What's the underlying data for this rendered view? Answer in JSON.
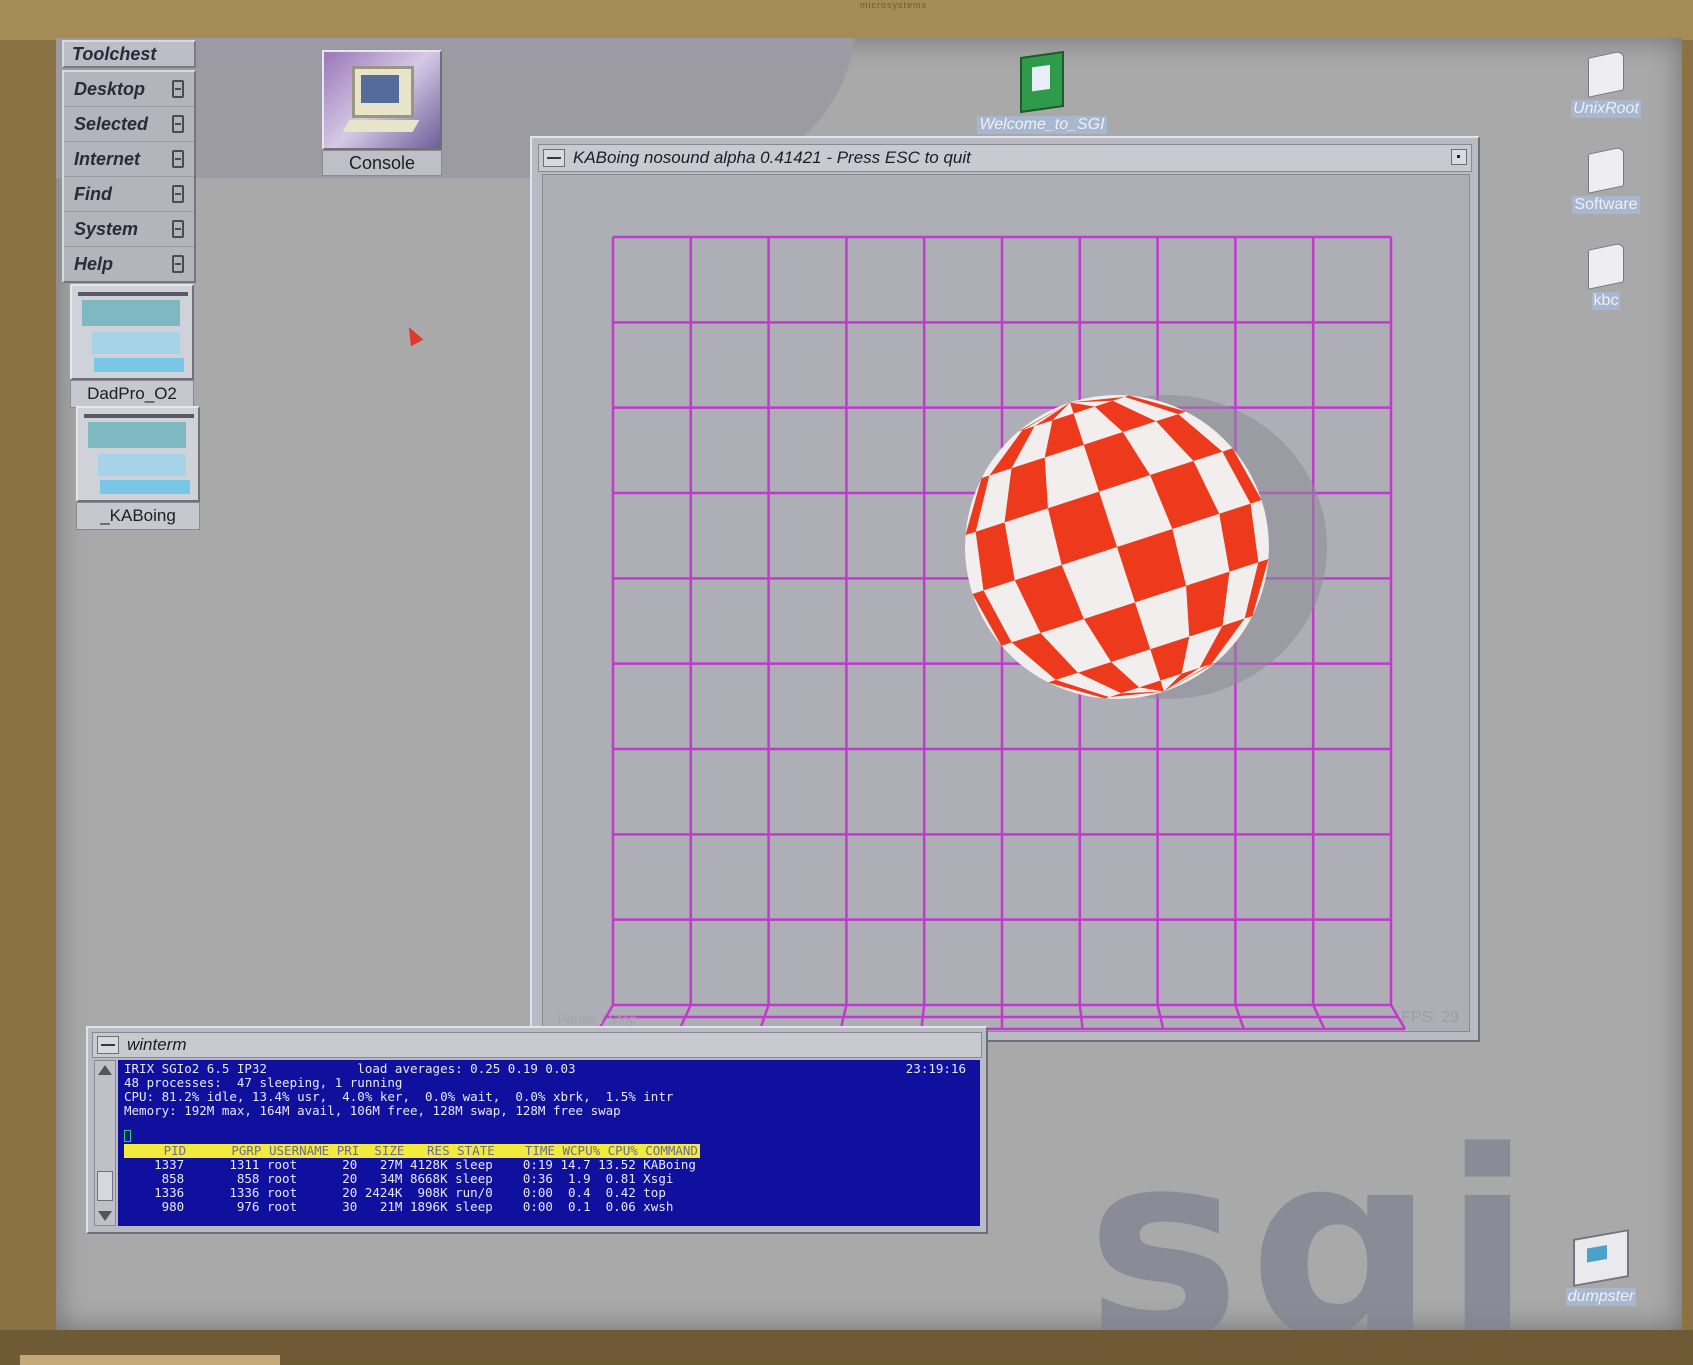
{
  "bezel": {
    "brand": "microsystems"
  },
  "toolchest": {
    "title": "Toolchest",
    "items": [
      {
        "label": "Desktop"
      },
      {
        "label": "Selected"
      },
      {
        "label": "Internet"
      },
      {
        "label": "Find"
      },
      {
        "label": "System"
      },
      {
        "label": "Help"
      }
    ]
  },
  "minimized_windows": [
    {
      "label": "DadPro_O2"
    },
    {
      "label": "_KABoing"
    }
  ],
  "console_icon": {
    "label": "Console"
  },
  "desktop_icons": {
    "welcome": {
      "label": "Welcome_to_SGI"
    },
    "unixroot": {
      "label": "UnixRoot"
    },
    "software": {
      "label": "Software"
    },
    "kbc": {
      "label": "kbc"
    },
    "dumpster": {
      "label": "dumpster"
    }
  },
  "kaboing_window": {
    "title": "KABoing nosound alpha 0.41421 - Press ESC to quit",
    "fps": "FPS: 29",
    "faint_text": "Pause / Stop",
    "colors": {
      "grid": "#c23acd",
      "ball_red": "#ee3a1c",
      "ball_white": "#f3eeee",
      "shadow": "#8c8d96"
    },
    "ball": {
      "rotation_deg": -18
    }
  },
  "winterm": {
    "title": "winterm",
    "time": "23:19:16",
    "lines": [
      "IRIX SGIo2 6.5 IP32            load averages: 0.25 0.19 0.03",
      "48 processes:  47 sleeping, 1 running",
      "CPU: 81.2% idle, 13.4% usr,  4.0% ker,  0.0% wait,  0.0% xbrk,  1.5% intr",
      "Memory: 192M max, 164M avail, 106M free, 128M swap, 128M free swap"
    ],
    "table_header": "     PID      PGRP USERNAME PRI  SIZE   RES STATE    TIME WCPU% CPU% COMMAND",
    "rows": [
      "    1337      1311 root      20   27M 4128K sleep    0:19 14.7 13.52 KABoing",
      "     858       858 root      20   34M 8668K sleep    0:36  1.9  0.81 Xsgi",
      "    1336      1336 root      20 2424K  908K run/0    0:00  0.4  0.42 top",
      "     980       976 root      30   21M 1896K sleep    0:00  0.1  0.06 xwsh"
    ]
  },
  "background_logo": "sgi"
}
